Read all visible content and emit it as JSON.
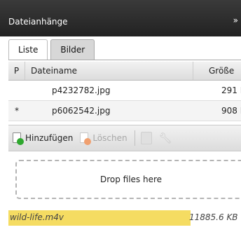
{
  "panel": {
    "title": "Dateianhänge",
    "collapse_glyph": "»"
  },
  "tabs": [
    {
      "label": "Liste",
      "active": true
    },
    {
      "label": "Bilder",
      "active": false
    }
  ],
  "table": {
    "columns": {
      "p": "P",
      "name": "Dateiname",
      "size": "Größe"
    },
    "rows": [
      {
        "p": "",
        "name": "p4232782.jpg",
        "size": "291 KB"
      },
      {
        "p": "*",
        "name": "p6062542.jpg",
        "size": "908 KB"
      }
    ]
  },
  "toolbar": {
    "add_label": "Hinzufügen",
    "delete_label": "Löschen",
    "add_icon": "add-document-icon",
    "delete_icon": "delete-document-icon",
    "paste_icon": "clipboard-icon",
    "settings_icon": "wrench-icon"
  },
  "dropzone": {
    "label": "Drop files here"
  },
  "upload": {
    "name": "wild-life.m4v",
    "size": "11885.6 KB",
    "progress_percent": 80,
    "bar_color": "#f5dc62"
  }
}
